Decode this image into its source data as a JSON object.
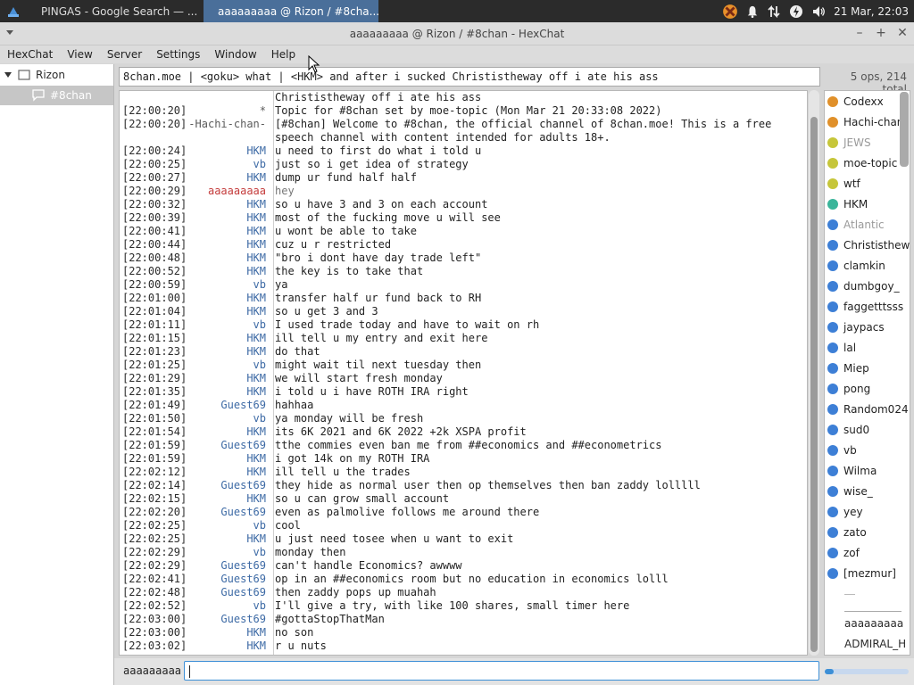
{
  "taskbar": {
    "tasks": [
      {
        "label": "PINGAS - Google Search — ...",
        "icon": "firefox-icon"
      },
      {
        "label": "aaaaaaaaa @ Rizon / #8cha...",
        "icon": "hexchat-icon"
      }
    ],
    "clock": "21 Mar, 22:03"
  },
  "window": {
    "title": "aaaaaaaaa @ Rizon / #8chan - HexChat"
  },
  "menubar": [
    "HexChat",
    "View",
    "Server",
    "Settings",
    "Window",
    "Help"
  ],
  "sidebar": {
    "server": "Rizon",
    "channel": "#8chan"
  },
  "topic": "8chan.moe | <goku> what | <HKM> and after i sucked Christistheway off i ate his ass",
  "ops_count": "5 ops, 214 total",
  "messages": [
    {
      "ts": "",
      "nick": "",
      "text": "Christistheway off i ate his ass"
    },
    {
      "ts": "[22:00:20]",
      "nick": "*",
      "text": "Topic for #8chan set by moe-topic (Mon Mar 21 20:33:08 2022)"
    },
    {
      "ts": "[22:00:20]",
      "nick": "-Hachi-chan-",
      "text": "[#8chan] Welcome to #8chan, the official channel of 8chan.moe! This is a free speech channel with content intended for adults 18+."
    },
    {
      "ts": "[22:00:24]",
      "nick": "HKM",
      "text": "u need to first do what i told u"
    },
    {
      "ts": "[22:00:25]",
      "nick": "vb",
      "text": "just so i get idea of strategy"
    },
    {
      "ts": "[22:00:27]",
      "nick": "HKM",
      "text": "dump ur fund half half"
    },
    {
      "ts": "[22:00:29]",
      "nick": "aaaaaaaaa",
      "text": "hey"
    },
    {
      "ts": "[22:00:32]",
      "nick": "HKM",
      "text": "so u have 3 and 3 on each account"
    },
    {
      "ts": "[22:00:39]",
      "nick": "HKM",
      "text": "most of the fucking move u will see"
    },
    {
      "ts": "[22:00:41]",
      "nick": "HKM",
      "text": "u wont be able to take"
    },
    {
      "ts": "[22:00:44]",
      "nick": "HKM",
      "text": "cuz u r restricted"
    },
    {
      "ts": "[22:00:48]",
      "nick": "HKM",
      "text": "\"bro i dont have day trade left\""
    },
    {
      "ts": "[22:00:52]",
      "nick": "HKM",
      "text": "the key is to take that"
    },
    {
      "ts": "[22:00:59]",
      "nick": "vb",
      "text": "ya"
    },
    {
      "ts": "[22:01:00]",
      "nick": "HKM",
      "text": "transfer half ur fund back to RH"
    },
    {
      "ts": "[22:01:04]",
      "nick": "HKM",
      "text": "so u get 3 and 3"
    },
    {
      "ts": "[22:01:11]",
      "nick": "vb",
      "text": "I used trade today and have to wait on rh"
    },
    {
      "ts": "[22:01:15]",
      "nick": "HKM",
      "text": "ill tell u my entry and exit here"
    },
    {
      "ts": "[22:01:23]",
      "nick": "HKM",
      "text": "do that"
    },
    {
      "ts": "[22:01:25]",
      "nick": "vb",
      "text": "might wait til next tuesday then"
    },
    {
      "ts": "[22:01:29]",
      "nick": "HKM",
      "text": "we will start fresh monday"
    },
    {
      "ts": "[22:01:35]",
      "nick": "HKM",
      "text": "i told u i have ROTH IRA right"
    },
    {
      "ts": "[22:01:49]",
      "nick": "Guest69",
      "text": "hahhaa"
    },
    {
      "ts": "[22:01:50]",
      "nick": "vb",
      "text": "ya monday will be fresh"
    },
    {
      "ts": "[22:01:54]",
      "nick": "HKM",
      "text": "its 6K 2021 and 6K 2022 +2k XSPA profit"
    },
    {
      "ts": "[22:01:59]",
      "nick": "Guest69",
      "text": "tthe commies even ban me from ##economics and ##econometrics"
    },
    {
      "ts": "[22:01:59]",
      "nick": "HKM",
      "text": "i got 14k on my ROTH IRA"
    },
    {
      "ts": "[22:02:12]",
      "nick": "HKM",
      "text": "ill tell u the trades"
    },
    {
      "ts": "[22:02:14]",
      "nick": "Guest69",
      "text": "they hide as normal user then op themselves then ban zaddy lolllll"
    },
    {
      "ts": "[22:02:15]",
      "nick": "HKM",
      "text": "so u can grow small account"
    },
    {
      "ts": "[22:02:20]",
      "nick": "Guest69",
      "text": "even as palmolive follows me around there"
    },
    {
      "ts": "[22:02:25]",
      "nick": "vb",
      "text": "cool"
    },
    {
      "ts": "[22:02:25]",
      "nick": "HKM",
      "text": "u just need tosee when u want to exit"
    },
    {
      "ts": "[22:02:29]",
      "nick": "vb",
      "text": "monday then"
    },
    {
      "ts": "[22:02:29]",
      "nick": "Guest69",
      "text": "can't handle Economics? awwww"
    },
    {
      "ts": "[22:02:41]",
      "nick": "Guest69",
      "text": "op in an ##economics room but no education in economics lolll"
    },
    {
      "ts": "[22:02:48]",
      "nick": "Guest69",
      "text": "then zaddy pops up muahah"
    },
    {
      "ts": "[22:02:52]",
      "nick": "vb",
      "text": "I'll give a try, with like 100 shares, small timer here"
    },
    {
      "ts": "[22:03:00]",
      "nick": "Guest69",
      "text": "#gottaStopThatMan"
    },
    {
      "ts": "[22:03:00]",
      "nick": "HKM",
      "text": "no son"
    },
    {
      "ts": "[22:03:02]",
      "nick": "HKM",
      "text": "r u nuts"
    }
  ],
  "users": [
    {
      "name": "Codexx",
      "color": "#e0902a",
      "text_color": "#222"
    },
    {
      "name": "Hachi-chan-",
      "color": "#e0902a",
      "text_color": "#222"
    },
    {
      "name": "JEWS",
      "color": "#c6c63a",
      "text_color": "#9a9a9a"
    },
    {
      "name": "moe-topic",
      "color": "#c6c63a",
      "text_color": "#222"
    },
    {
      "name": "wtf",
      "color": "#c6c63a",
      "text_color": "#222"
    },
    {
      "name": "HKM",
      "color": "#3ab59a",
      "text_color": "#222"
    },
    {
      "name": "Atlantic",
      "color": "#3d7fd6",
      "text_color": "#9a9a9a"
    },
    {
      "name": "Christistheway",
      "color": "#3d7fd6",
      "text_color": "#222"
    },
    {
      "name": "clamkin",
      "color": "#3d7fd6",
      "text_color": "#222"
    },
    {
      "name": "dumbgoy_",
      "color": "#3d7fd6",
      "text_color": "#222"
    },
    {
      "name": "faggetttsss",
      "color": "#3d7fd6",
      "text_color": "#222"
    },
    {
      "name": "jaypacs",
      "color": "#3d7fd6",
      "text_color": "#222"
    },
    {
      "name": "lal",
      "color": "#3d7fd6",
      "text_color": "#222"
    },
    {
      "name": "Miep",
      "color": "#3d7fd6",
      "text_color": "#222"
    },
    {
      "name": "pong",
      "color": "#3d7fd6",
      "text_color": "#222"
    },
    {
      "name": "Random024",
      "color": "#3d7fd6",
      "text_color": "#222"
    },
    {
      "name": "sud0",
      "color": "#3d7fd6",
      "text_color": "#222"
    },
    {
      "name": "vb",
      "color": "#3d7fd6",
      "text_color": "#222"
    },
    {
      "name": "Wilma",
      "color": "#3d7fd6",
      "text_color": "#222"
    },
    {
      "name": "wise_",
      "color": "#3d7fd6",
      "text_color": "#222"
    },
    {
      "name": "yey",
      "color": "#3d7fd6",
      "text_color": "#222"
    },
    {
      "name": "zato",
      "color": "#3d7fd6",
      "text_color": "#222"
    },
    {
      "name": "zof",
      "color": "#3d7fd6",
      "text_color": "#222"
    },
    {
      "name": "[mezmur]",
      "color": "#3d7fd6",
      "text_color": "#222"
    }
  ],
  "users_plain": [
    "aaaaaaaaa",
    "ADMIRAL_H"
  ],
  "input": {
    "nick": "aaaaaaaaa",
    "value": ""
  }
}
